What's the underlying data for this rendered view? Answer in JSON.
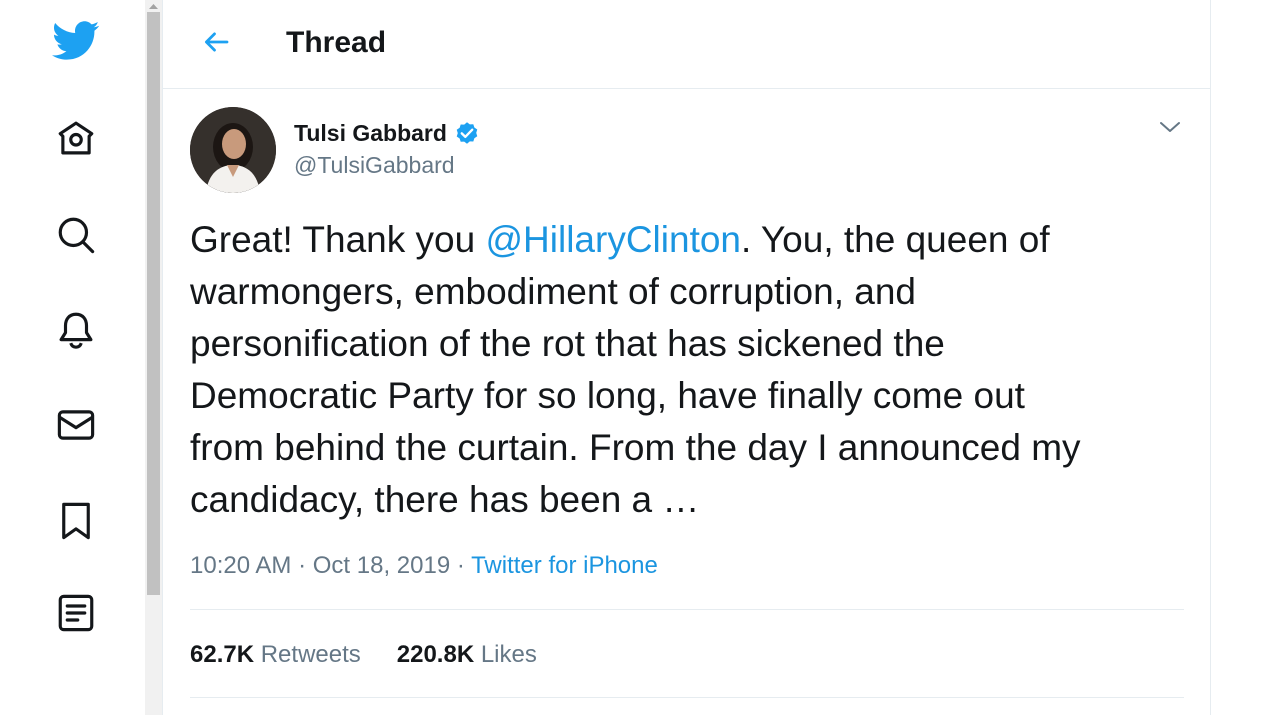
{
  "nav": {
    "items": [
      {
        "icon": "twitter-bird-icon"
      },
      {
        "icon": "home-icon"
      },
      {
        "icon": "search-icon"
      },
      {
        "icon": "notifications-bell-icon"
      },
      {
        "icon": "messages-envelope-icon"
      },
      {
        "icon": "bookmark-icon"
      },
      {
        "icon": "lists-icon"
      }
    ],
    "accent": "#1da1f2"
  },
  "header": {
    "title": "Thread"
  },
  "tweet": {
    "author_name": "Tulsi Gabbard",
    "author_handle": "@TulsiGabbard",
    "verified": true,
    "text_lines": [
      {
        "before": "Great! Thank you ",
        "mention": "@HillaryClinton",
        "after": ". You, the queen of"
      },
      {
        "text": "warmongers, embodiment of corruption, and"
      },
      {
        "text": "personification of the rot that has sickened the"
      },
      {
        "text": "Democratic Party for so long, have finally come out"
      },
      {
        "text": "from behind the curtain. From the day I announced my"
      },
      {
        "text": "candidacy, there has been a …"
      }
    ],
    "time": "10:20 AM",
    "date": "Oct 18, 2019",
    "separator": "·",
    "source": "Twitter for iPhone",
    "retweets_count": "62.7K",
    "retweets_label": "Retweets",
    "likes_count": "220.8K",
    "likes_label": "Likes"
  },
  "colors": {
    "link": "#1b95e0",
    "secondary_text": "#657786",
    "primary_text": "#14171a",
    "border": "#e6ecf0"
  }
}
